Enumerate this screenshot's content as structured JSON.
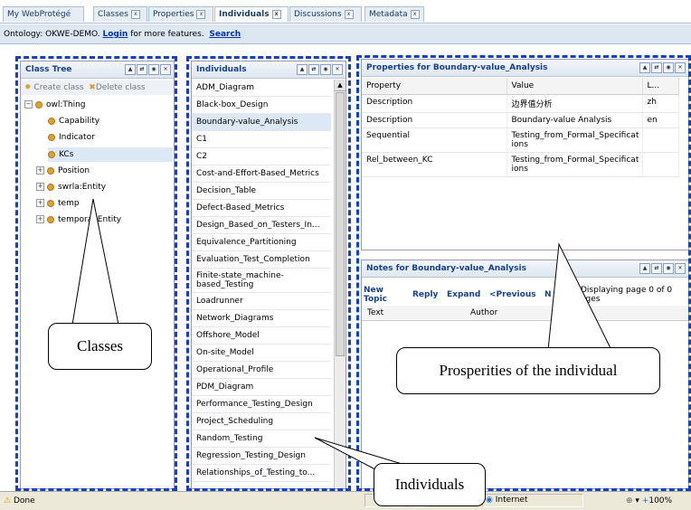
{
  "tabs": [
    {
      "label": "My WebProtégé"
    },
    {
      "label": "Classes"
    },
    {
      "label": "Properties"
    },
    {
      "label": "Individuals"
    },
    {
      "label": "Discussions"
    },
    {
      "label": "Metadata"
    }
  ],
  "infobar": {
    "ontology": "Ontology: OKWE-DEMO.",
    "login": "Login",
    "more": "for more features.",
    "search": "Search"
  },
  "class_tree": {
    "title": "Class Tree",
    "create": "Create class",
    "delete": "Delete class",
    "items": [
      "owl:Thing",
      "Capability",
      "Indicator",
      "KCs",
      "Position",
      "swrla:Entity",
      "temp",
      "temporal:Entity"
    ]
  },
  "individuals": {
    "title": "Individuals",
    "items": [
      "ADM_Diagram",
      "Black-box_Design",
      "Boundary-value_Analysis",
      "C1",
      "C2",
      "Cost-and-Effort-Based_Metrics",
      "Decision_Table",
      "Defect-Based_Metrics",
      "Design_Based_on_Testers_In...",
      "Equivalence_Partitioning",
      "Evaluation_Test_Completion",
      "Finite-state_machine-based_Testing",
      "Loadrunner",
      "Network_Diagrams",
      "Offshore_Model",
      "On-site_Model",
      "Operational_Profile",
      "PDM_Diagram",
      "Performance_Testing_Design",
      "Project_Scheduling",
      "Random_Testing",
      "Regression_Testing_Design",
      "Relationships_of_Testing_to..."
    ]
  },
  "properties": {
    "title": "Properties for Boundary-value_Analysis",
    "headers": [
      "Property",
      "Value",
      "L..."
    ],
    "rows": [
      [
        "Description",
        "边界值分析",
        "zh"
      ],
      [
        "Description",
        "Boundary-value Analysis",
        "en"
      ],
      [
        "Sequential",
        "Testing_from_Formal_Specificat ions",
        ""
      ],
      [
        "Rel_between_KC",
        "Testing_from_Formal_Specificat ions",
        ""
      ]
    ]
  },
  "notes": {
    "title": "Notes for Boundary-value_Analysis",
    "new_topic": "New Topic",
    "reply": "Reply",
    "expand": "Expand",
    "previous": "<Previous",
    "next": "N",
    "paging": "Displaying page 0 of 0 ages",
    "headers": [
      "Text",
      "Author"
    ]
  },
  "callouts": {
    "classes": "Classes",
    "props": "Prosperities of the individual",
    "individuals": "Individuals"
  },
  "status": {
    "done": "Done",
    "zone": "Internet",
    "zoom": "100%"
  },
  "colors": {
    "dash": "#1440c8",
    "header_text": "#15428b"
  }
}
